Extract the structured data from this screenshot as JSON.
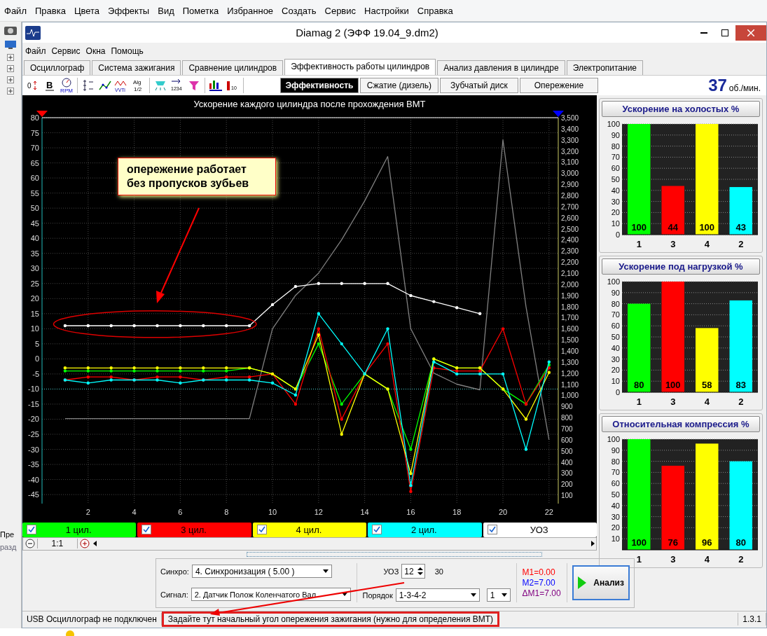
{
  "outer_menu": [
    "Файл",
    "Правка",
    "Цвета",
    "Эффекты",
    "Вид",
    "Пометка",
    "Избранное",
    "Создать",
    "Сервис",
    "Настройки",
    "Справка"
  ],
  "left_strip": {
    "texts": [
      "Пре",
      "разд"
    ]
  },
  "window": {
    "title": "Diamag 2 (ЭФФ 19.04_9.dm2)"
  },
  "menu": [
    "Файл",
    "Сервис",
    "Окна",
    "Помощь"
  ],
  "tabs": [
    {
      "label": "Осциллограф",
      "selected": false
    },
    {
      "label": "Система зажигания",
      "selected": false
    },
    {
      "label": "Сравнение цилиндров",
      "selected": false
    },
    {
      "label": "Эффективность работы цилиндров",
      "selected": true
    },
    {
      "label": "Анализ давления в цилиндре",
      "selected": false
    },
    {
      "label": "Электропитание",
      "selected": false
    }
  ],
  "tool_groups": [
    [
      {
        "kind": "zero",
        "label": "0"
      },
      {
        "kind": "bold",
        "label": "B"
      },
      {
        "kind": "gauge",
        "label": "RPM"
      }
    ],
    [
      {
        "kind": "scale"
      },
      {
        "kind": "line"
      },
      {
        "kind": "vvti",
        "label": "VVTi"
      },
      {
        "kind": "alg",
        "label": "Alg 1/2"
      }
    ],
    [
      {
        "kind": "pump"
      },
      {
        "kind": "sort",
        "label": "1234"
      },
      {
        "kind": "filter"
      }
    ],
    [
      {
        "kind": "bars"
      },
      {
        "kind": "level",
        "label": "10"
      }
    ]
  ],
  "subtabs": [
    {
      "label": "Эффективность",
      "selected": true
    },
    {
      "label": "Сжатие (дизель)",
      "selected": false
    },
    {
      "label": "Зубчатый диск",
      "selected": false
    },
    {
      "label": "Опережение",
      "selected": false
    }
  ],
  "rpm": {
    "value": "37",
    "unit": "об./мин."
  },
  "chart_data": {
    "type": "line",
    "title": "Ускорение каждого цилиндра после прохождения ВМТ",
    "x": [
      1,
      2,
      3,
      4,
      5,
      6,
      7,
      8,
      9,
      10,
      11,
      12,
      13,
      14,
      15,
      16,
      17,
      18,
      19,
      20,
      21,
      22
    ],
    "xlim": [
      0,
      22.4
    ],
    "xticks": [
      2,
      4,
      6,
      8,
      10,
      12,
      14,
      16,
      18,
      20,
      22
    ],
    "ylim": [
      -48,
      80
    ],
    "yticks": [
      -45,
      -40,
      -35,
      -30,
      -25,
      -20,
      -15,
      -10,
      -5,
      0,
      5,
      10,
      15,
      20,
      25,
      30,
      35,
      40,
      45,
      50,
      55,
      60,
      65,
      70,
      75,
      80
    ],
    "y2lim": [
      25,
      3500
    ],
    "y2ticks": [
      {
        "value": 100,
        "label": "100"
      },
      {
        "value": 200,
        "label": "200"
      },
      {
        "value": 300,
        "label": "300"
      },
      {
        "value": 400,
        "label": "400"
      },
      {
        "value": 500,
        "label": "500"
      },
      {
        "value": 600,
        "label": "600"
      },
      {
        "value": 700,
        "label": "700"
      },
      {
        "value": 800,
        "label": "800"
      },
      {
        "value": 900,
        "label": "900"
      },
      {
        "value": 1000,
        "label": "1,000"
      },
      {
        "value": 1100,
        "label": "1,100"
      },
      {
        "value": 1200,
        "label": "1,200"
      },
      {
        "value": 1300,
        "label": "1,300"
      },
      {
        "value": 1400,
        "label": "1,400"
      },
      {
        "value": 1500,
        "label": "1,500"
      },
      {
        "value": 1600,
        "label": "1,600"
      },
      {
        "value": 1700,
        "label": "1,700"
      },
      {
        "value": 1800,
        "label": "1,800"
      },
      {
        "value": 1900,
        "label": "1,900"
      },
      {
        "value": 2000,
        "label": "2,000"
      },
      {
        "value": 2100,
        "label": "2,100"
      },
      {
        "value": 2200,
        "label": "2,200"
      },
      {
        "value": 2300,
        "label": "2,300"
      },
      {
        "value": 2400,
        "label": "2,400"
      },
      {
        "value": 2500,
        "label": "2,500"
      },
      {
        "value": 2600,
        "label": "2,600"
      },
      {
        "value": 2700,
        "label": "2,700"
      },
      {
        "value": 2800,
        "label": "2,800"
      },
      {
        "value": 2900,
        "label": "2,900"
      },
      {
        "value": 3000,
        "label": "3,000"
      },
      {
        "value": 3100,
        "label": "3,100"
      },
      {
        "value": 3200,
        "label": "3,200"
      },
      {
        "value": 3300,
        "label": "3,300"
      },
      {
        "value": 3400,
        "label": "3,400"
      },
      {
        "value": 3500,
        "label": "3,500"
      }
    ],
    "series": [
      {
        "color": "#808080",
        "axis": "y2",
        "values": [
          790,
          790,
          790,
          790,
          790,
          790,
          790,
          790,
          790,
          1600,
          1900,
          2100,
          2400,
          2750,
          3150,
          1600,
          1200,
          1100,
          1050,
          3300,
          1800,
          600
        ]
      },
      {
        "name": "1 цил.",
        "color": "#00ff00",
        "values": [
          -4,
          -4,
          -4,
          -4,
          -4,
          -4,
          -4,
          -4,
          -3,
          -5,
          -10,
          5,
          -15,
          -5,
          -10,
          -30,
          0,
          -3,
          -3,
          -10,
          -15,
          -2
        ]
      },
      {
        "name": "3 цил.",
        "color": "#ff0000",
        "values": [
          -7,
          -6,
          -6,
          -7,
          -6,
          -6,
          -7,
          -6,
          -6,
          -5,
          -15,
          10,
          -20,
          -5,
          5,
          -44,
          -3,
          -4,
          -4,
          10,
          -15,
          -3
        ]
      },
      {
        "name": "4 цил.",
        "color": "#ffff00",
        "values": [
          -3,
          -3,
          -3,
          -3,
          -3,
          -3,
          -3,
          -3,
          -3,
          -5,
          -10,
          8,
          -25,
          -5,
          -10,
          -38,
          0,
          -3,
          -3,
          -10,
          -20,
          -4.5
        ]
      },
      {
        "name": "2 цил.",
        "color": "#00ffff",
        "values": [
          -7,
          -8,
          -7,
          -7,
          -7,
          -8,
          -7,
          -7,
          -7,
          -8,
          -12,
          15,
          5,
          -5,
          10,
          -42,
          -1,
          -5,
          -5,
          -5,
          -30,
          -1
        ]
      },
      {
        "name": "УОЗ",
        "color": "#ffffff",
        "values": [
          11,
          11,
          11,
          11,
          11,
          11,
          11,
          11,
          11,
          18,
          24,
          25,
          25,
          25,
          25,
          21,
          19,
          17,
          15,
          null,
          null,
          null
        ]
      }
    ],
    "annotations": [
      {
        "text": "опережение работает без пропусков зубьев"
      }
    ],
    "grid": true,
    "ref_lines": [
      {
        "axis": "y",
        "value": -10,
        "color": "#44cccc"
      }
    ]
  },
  "legend": [
    {
      "checked": true
    },
    {
      "checked": true
    },
    {
      "checked": true
    },
    {
      "checked": true
    },
    {
      "checked": true
    }
  ],
  "zoom": {
    "label": "1:1"
  },
  "bar_charts": [
    {
      "chart_data": {
        "type": "bar",
        "title": "Ускорение на холостых %",
        "categories": [
          "1",
          "3",
          "4",
          "2"
        ],
        "values": [
          100,
          44,
          100,
          43
        ],
        "grid": true,
        "ylim": [
          0,
          100
        ],
        "yticks": [
          0,
          10,
          20,
          30,
          40,
          50,
          60,
          70,
          80,
          90,
          100
        ],
        "data_labels": true,
        "colors": [
          "#00ff00",
          "#ff0000",
          "#ffff00",
          "#00ffff"
        ]
      }
    },
    {
      "chart_data": {
        "type": "bar",
        "title": "Ускорение под нагрузкой %",
        "categories": [
          "1",
          "3",
          "4",
          "2"
        ],
        "values": [
          80,
          100,
          58,
          83
        ],
        "grid": true,
        "ylim": [
          0,
          100
        ],
        "yticks": [
          0,
          10,
          20,
          30,
          40,
          50,
          60,
          70,
          80,
          90,
          100
        ],
        "data_labels": true,
        "colors": [
          "#00ff00",
          "#ff0000",
          "#ffff00",
          "#00ffff"
        ]
      }
    },
    {
      "chart_data": {
        "type": "bar",
        "title": "Относительная компрессия %",
        "categories": [
          "1",
          "3",
          "4",
          "2"
        ],
        "values": [
          100,
          76,
          96,
          80
        ],
        "grid": true,
        "ylim": [
          0,
          100
        ],
        "yticks": [
          10,
          20,
          30,
          40,
          50,
          60,
          70,
          80,
          90,
          100
        ],
        "data_labels": true,
        "colors": [
          "#00ff00",
          "#ff0000",
          "#ffff00",
          "#00ffff"
        ]
      }
    }
  ],
  "controls": {
    "sync": {
      "label": "Синхро:",
      "value": "4.  Синхронизация ( 5.00 )"
    },
    "signal": {
      "label": "Сигнал:",
      "value": "2.  Датчик Полож Коленчатого Вал"
    },
    "uoz": {
      "label": "УОЗ",
      "value": "12",
      "extra": "30"
    },
    "order": {
      "label": "Порядок",
      "value": "1-3-4-2",
      "second": "1"
    },
    "markers": [
      {
        "text": "M1=0.00",
        "color": "#ff0000"
      },
      {
        "text": "M2=7.00",
        "color": "#0000ff"
      },
      {
        "text": "ΔM1=7.00",
        "color": "#800080"
      }
    ],
    "analyze": "Анализ"
  },
  "status_bar": [
    {
      "text": "USB Осциллограф не подключен",
      "highlighted": false
    },
    {
      "text": "Задайте тут начальный угол опережения зажигания (нужно для определения ВМТ)",
      "highlighted": true
    },
    {
      "text": "1.3.1",
      "highlighted": false
    }
  ]
}
